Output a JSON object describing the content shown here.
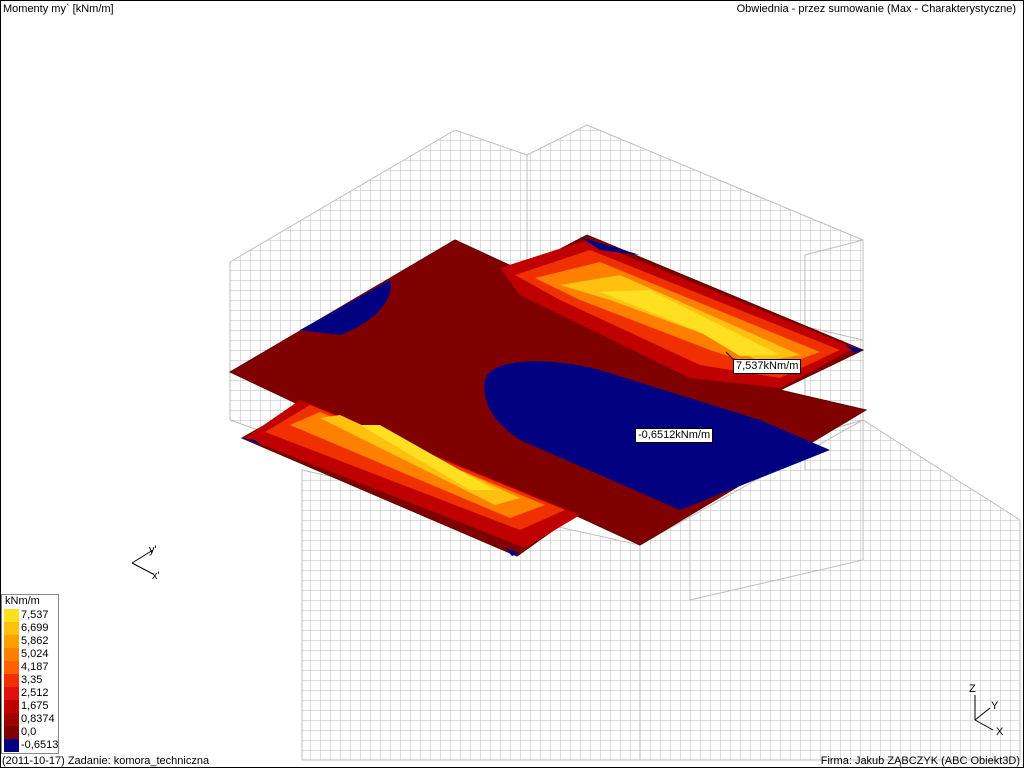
{
  "header": {
    "result_title": "Momenty my` [kNm/m]",
    "envelope_title": "Obwiednia - przez sumowanie (Max - Charakterystyczne)"
  },
  "footer": {
    "task": "(2011-10-17) Zadanie: komora_techniczna",
    "company": "Firma: Jakub ZĄBCZYK (ABC Obiekt3D)"
  },
  "legend": {
    "unit": "kNm/m",
    "entries": [
      {
        "label": "7,537",
        "color": "#ffe020"
      },
      {
        "label": "6,699",
        "color": "#ffc010"
      },
      {
        "label": "5,862",
        "color": "#ffa000"
      },
      {
        "label": "5,024",
        "color": "#ff8000"
      },
      {
        "label": "4,187",
        "color": "#ff6000"
      },
      {
        "label": "3,35",
        "color": "#f03000"
      },
      {
        "label": "2,512",
        "color": "#e01010"
      },
      {
        "label": "1,675",
        "color": "#c00000"
      },
      {
        "label": "0,8374",
        "color": "#a00000"
      },
      {
        "label": "0,0",
        "color": "#800000"
      },
      {
        "label": "-0,6513",
        "color": "#000080"
      }
    ]
  },
  "annotations": {
    "max": "7,537kNm/m",
    "min": "-0,6512kNm/m"
  },
  "axes": {
    "local_y": "y'",
    "local_x": "x'",
    "global_z": "Z",
    "global_y": "Y",
    "global_x": "X"
  },
  "colors": {
    "negative": "#000080",
    "zero": "#800000",
    "mesh": "#b8b8b8"
  }
}
